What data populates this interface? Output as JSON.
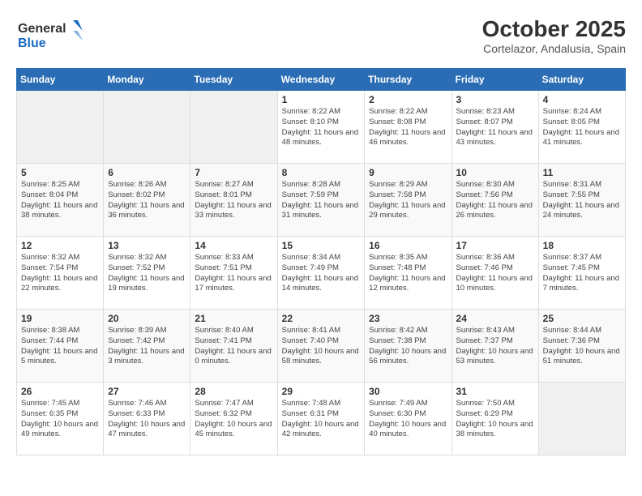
{
  "header": {
    "logo_line1": "General",
    "logo_line2": "Blue",
    "title": "October 2025",
    "subtitle": "Cortelazor, Andalusia, Spain"
  },
  "weekdays": [
    "Sunday",
    "Monday",
    "Tuesday",
    "Wednesday",
    "Thursday",
    "Friday",
    "Saturday"
  ],
  "weeks": [
    [
      {
        "day": "",
        "info": ""
      },
      {
        "day": "",
        "info": ""
      },
      {
        "day": "",
        "info": ""
      },
      {
        "day": "1",
        "info": "Sunrise: 8:22 AM\nSunset: 8:10 PM\nDaylight: 11 hours and 48 minutes."
      },
      {
        "day": "2",
        "info": "Sunrise: 8:22 AM\nSunset: 8:08 PM\nDaylight: 11 hours and 46 minutes."
      },
      {
        "day": "3",
        "info": "Sunrise: 8:23 AM\nSunset: 8:07 PM\nDaylight: 11 hours and 43 minutes."
      },
      {
        "day": "4",
        "info": "Sunrise: 8:24 AM\nSunset: 8:05 PM\nDaylight: 11 hours and 41 minutes."
      }
    ],
    [
      {
        "day": "5",
        "info": "Sunrise: 8:25 AM\nSunset: 8:04 PM\nDaylight: 11 hours and 38 minutes."
      },
      {
        "day": "6",
        "info": "Sunrise: 8:26 AM\nSunset: 8:02 PM\nDaylight: 11 hours and 36 minutes."
      },
      {
        "day": "7",
        "info": "Sunrise: 8:27 AM\nSunset: 8:01 PM\nDaylight: 11 hours and 33 minutes."
      },
      {
        "day": "8",
        "info": "Sunrise: 8:28 AM\nSunset: 7:59 PM\nDaylight: 11 hours and 31 minutes."
      },
      {
        "day": "9",
        "info": "Sunrise: 8:29 AM\nSunset: 7:58 PM\nDaylight: 11 hours and 29 minutes."
      },
      {
        "day": "10",
        "info": "Sunrise: 8:30 AM\nSunset: 7:56 PM\nDaylight: 11 hours and 26 minutes."
      },
      {
        "day": "11",
        "info": "Sunrise: 8:31 AM\nSunset: 7:55 PM\nDaylight: 11 hours and 24 minutes."
      }
    ],
    [
      {
        "day": "12",
        "info": "Sunrise: 8:32 AM\nSunset: 7:54 PM\nDaylight: 11 hours and 22 minutes."
      },
      {
        "day": "13",
        "info": "Sunrise: 8:32 AM\nSunset: 7:52 PM\nDaylight: 11 hours and 19 minutes."
      },
      {
        "day": "14",
        "info": "Sunrise: 8:33 AM\nSunset: 7:51 PM\nDaylight: 11 hours and 17 minutes."
      },
      {
        "day": "15",
        "info": "Sunrise: 8:34 AM\nSunset: 7:49 PM\nDaylight: 11 hours and 14 minutes."
      },
      {
        "day": "16",
        "info": "Sunrise: 8:35 AM\nSunset: 7:48 PM\nDaylight: 11 hours and 12 minutes."
      },
      {
        "day": "17",
        "info": "Sunrise: 8:36 AM\nSunset: 7:46 PM\nDaylight: 11 hours and 10 minutes."
      },
      {
        "day": "18",
        "info": "Sunrise: 8:37 AM\nSunset: 7:45 PM\nDaylight: 11 hours and 7 minutes."
      }
    ],
    [
      {
        "day": "19",
        "info": "Sunrise: 8:38 AM\nSunset: 7:44 PM\nDaylight: 11 hours and 5 minutes."
      },
      {
        "day": "20",
        "info": "Sunrise: 8:39 AM\nSunset: 7:42 PM\nDaylight: 11 hours and 3 minutes."
      },
      {
        "day": "21",
        "info": "Sunrise: 8:40 AM\nSunset: 7:41 PM\nDaylight: 11 hours and 0 minutes."
      },
      {
        "day": "22",
        "info": "Sunrise: 8:41 AM\nSunset: 7:40 PM\nDaylight: 10 hours and 58 minutes."
      },
      {
        "day": "23",
        "info": "Sunrise: 8:42 AM\nSunset: 7:38 PM\nDaylight: 10 hours and 56 minutes."
      },
      {
        "day": "24",
        "info": "Sunrise: 8:43 AM\nSunset: 7:37 PM\nDaylight: 10 hours and 53 minutes."
      },
      {
        "day": "25",
        "info": "Sunrise: 8:44 AM\nSunset: 7:36 PM\nDaylight: 10 hours and 51 minutes."
      }
    ],
    [
      {
        "day": "26",
        "info": "Sunrise: 7:45 AM\nSunset: 6:35 PM\nDaylight: 10 hours and 49 minutes."
      },
      {
        "day": "27",
        "info": "Sunrise: 7:46 AM\nSunset: 6:33 PM\nDaylight: 10 hours and 47 minutes."
      },
      {
        "day": "28",
        "info": "Sunrise: 7:47 AM\nSunset: 6:32 PM\nDaylight: 10 hours and 45 minutes."
      },
      {
        "day": "29",
        "info": "Sunrise: 7:48 AM\nSunset: 6:31 PM\nDaylight: 10 hours and 42 minutes."
      },
      {
        "day": "30",
        "info": "Sunrise: 7:49 AM\nSunset: 6:30 PM\nDaylight: 10 hours and 40 minutes."
      },
      {
        "day": "31",
        "info": "Sunrise: 7:50 AM\nSunset: 6:29 PM\nDaylight: 10 hours and 38 minutes."
      },
      {
        "day": "",
        "info": ""
      }
    ]
  ]
}
